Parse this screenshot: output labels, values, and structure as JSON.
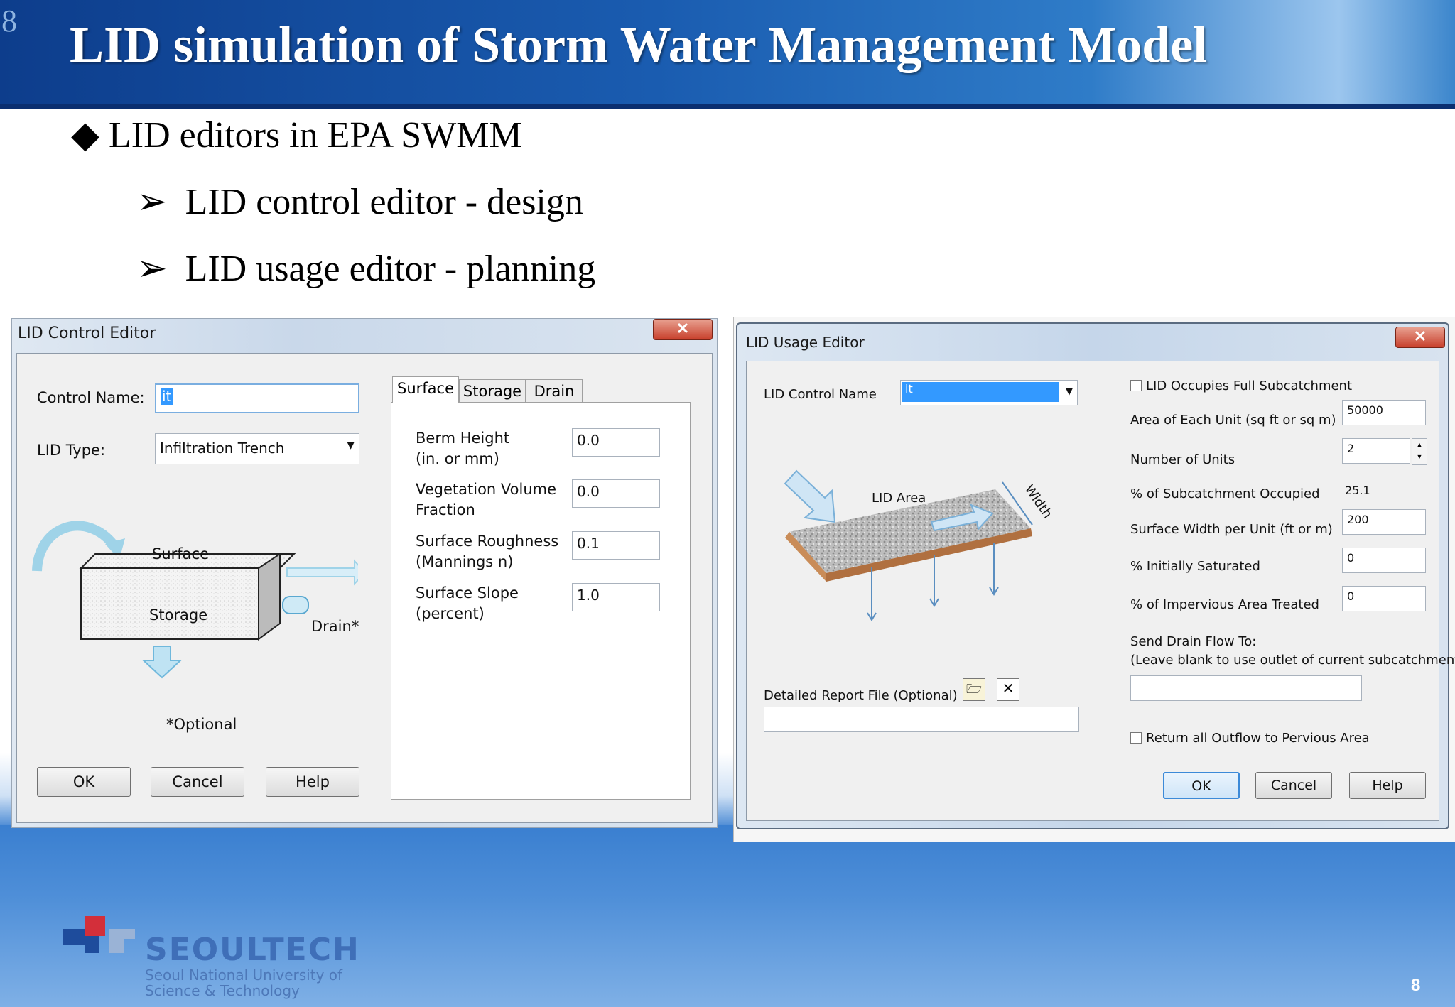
{
  "slide": {
    "page_number": "8",
    "title": "LID simulation of Storm Water Management Model",
    "bullet": "LID editors in EPA SWMM",
    "bullet_glyph": "◆",
    "sub_glyph": "➢",
    "sub_items": [
      "LID control editor - design",
      "LID usage editor - planning"
    ],
    "logo": {
      "name": "SEOULTECH",
      "line1": "Seoul National University of",
      "line2": "Science & Technology"
    }
  },
  "control_editor": {
    "title": "LID Control Editor",
    "control_name_label": "Control Name:",
    "control_name_value": "it",
    "lid_type_label": "LID Type:",
    "lid_type_value": "Infiltration Trench",
    "diagram": {
      "surface": "Surface",
      "storage": "Storage",
      "drain": "Drain*"
    },
    "optional_note": "*Optional",
    "buttons": {
      "ok": "OK",
      "cancel": "Cancel",
      "help": "Help"
    },
    "tabs": [
      "Surface",
      "Storage",
      "Drain"
    ],
    "params": [
      {
        "line1": "Berm Height",
        "line2": "(in. or mm)",
        "value": "0.0"
      },
      {
        "line1": "Vegetation Volume",
        "line2": "Fraction",
        "value": "0.0"
      },
      {
        "line1": "Surface Roughness",
        "line2": "(Mannings n)",
        "value": "0.1"
      },
      {
        "line1": "Surface Slope",
        "line2": "(percent)",
        "value": "1.0"
      }
    ]
  },
  "usage_editor": {
    "title": "LID Usage Editor",
    "control_name_label": "LID Control Name",
    "control_name_value": "it",
    "diagram": {
      "area": "LID Area",
      "width": "Width"
    },
    "report_label": "Detailed Report File (Optional)",
    "report_value": "",
    "full_subcatchment_label": "LID Occupies Full Subcatchment",
    "full_subcatchment_checked": false,
    "fields": [
      {
        "label": "Area of Each Unit (sq ft or sq m)",
        "value": "50000"
      },
      {
        "label": "Number of Units",
        "value": "2"
      },
      {
        "label": "% of Subcatchment Occupied",
        "value": "25.1"
      },
      {
        "label": "Surface Width per Unit (ft or m)",
        "value": "200"
      },
      {
        "label": "% Initially Saturated",
        "value": "0"
      },
      {
        "label": "% of Impervious Area Treated",
        "value": "0"
      }
    ],
    "drain_label_1": "Send Drain Flow To:",
    "drain_label_2": "(Leave blank to use outlet of current subcatchment)",
    "drain_value": "",
    "return_outflow_label": "Return all Outflow to Pervious Area",
    "return_outflow_checked": false,
    "buttons": {
      "ok": "OK",
      "cancel": "Cancel",
      "help": "Help"
    }
  },
  "colors": {
    "header_blue": "#1a5cb0",
    "selection_blue": "#3399ff",
    "close_red": "#c8402c"
  }
}
